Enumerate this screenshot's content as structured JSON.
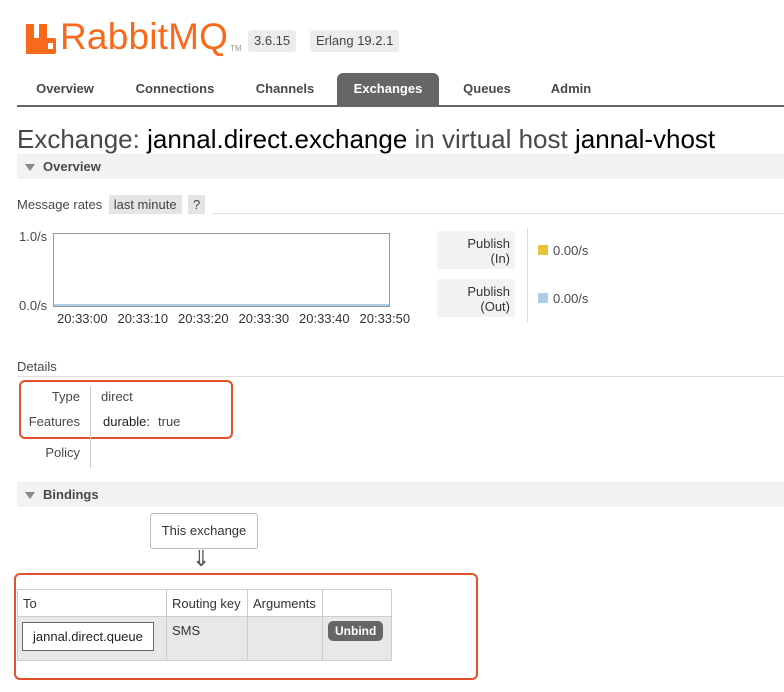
{
  "header": {
    "logo_text": "RabbitMQ",
    "logo_tm": "TM",
    "version": "3.6.15",
    "erlang": "Erlang 19.2.1"
  },
  "nav": {
    "tabs": [
      {
        "label": "Overview"
      },
      {
        "label": "Connections"
      },
      {
        "label": "Channels"
      },
      {
        "label": "Exchanges",
        "active": true
      },
      {
        "label": "Queues"
      },
      {
        "label": "Admin"
      }
    ]
  },
  "title": {
    "prefix": "Exchange:",
    "exchange_name": "jannal.direct.exchange",
    "middle": "in virtual host",
    "vhost": "jannal-vhost"
  },
  "overview": {
    "section_label": "Overview",
    "rates_label": "Message rates",
    "range_label": "last minute",
    "help_label": "?",
    "legend": [
      {
        "line1": "Publish",
        "line2": "(In)",
        "value": "0.00/s",
        "color": "#e8c43a"
      },
      {
        "line1": "Publish",
        "line2": "(Out)",
        "value": "0.00/s",
        "color": "#aacde9"
      }
    ]
  },
  "chart_data": {
    "type": "line",
    "x": [
      "20:33:00",
      "20:33:10",
      "20:33:20",
      "20:33:30",
      "20:33:40",
      "20:33:50"
    ],
    "ytick_top": "1.0/s",
    "ytick_bottom": "0.0/s",
    "ylim": [
      0,
      1
    ],
    "series": [
      {
        "name": "Publish (In)",
        "values": [
          0,
          0,
          0,
          0,
          0,
          0
        ],
        "color": "#e8c43a"
      },
      {
        "name": "Publish (Out)",
        "values": [
          0,
          0,
          0,
          0,
          0,
          0
        ],
        "color": "#aacde9"
      }
    ]
  },
  "details": {
    "section_label": "Details",
    "type_label": "Type",
    "type_value": "direct",
    "features_label": "Features",
    "features_key": "durable:",
    "features_value": "true",
    "policy_label": "Policy"
  },
  "bindings": {
    "section_label": "Bindings",
    "this_exchange": "This exchange",
    "arrow": "⇓",
    "columns": [
      "To",
      "Routing key",
      "Arguments",
      ""
    ],
    "rows": [
      {
        "to": "jannal.direct.queue",
        "routing_key": "SMS",
        "arguments": "",
        "action": "Unbind"
      }
    ]
  }
}
